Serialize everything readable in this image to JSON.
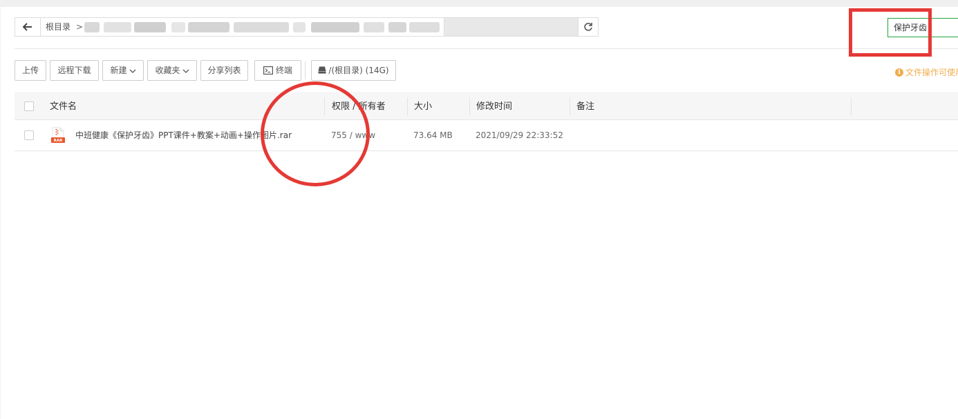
{
  "pathbar": {
    "root_label": "根目录",
    "separator": ">"
  },
  "search": {
    "value": "保护牙齿"
  },
  "toolbar": {
    "upload": "上传",
    "remote_download": "远程下载",
    "new": "新建",
    "favorites": "收藏夹",
    "share_list": "分享列表",
    "terminal": "终端",
    "disk": "/(根目录) (14G)"
  },
  "notice": {
    "text": "文件操作可使用"
  },
  "table": {
    "headers": {
      "name": "文件名",
      "perm": "权限 / 所有者",
      "size": "大小",
      "mtime": "修改时间",
      "note": "备注"
    },
    "rows": [
      {
        "name": "中班健康《保护牙齿》PPT课件+教案+动画+操作图片.rar",
        "perm": "755 / www",
        "size": "73.64 MB",
        "mtime": "2021/09/29 22:33:52",
        "note": "",
        "icon": "rar-file-icon",
        "icon_label": "RAR"
      }
    ]
  },
  "colors": {
    "accent": "#20a53a",
    "warning": "#f0ad4e",
    "annotation": "#e53935"
  }
}
